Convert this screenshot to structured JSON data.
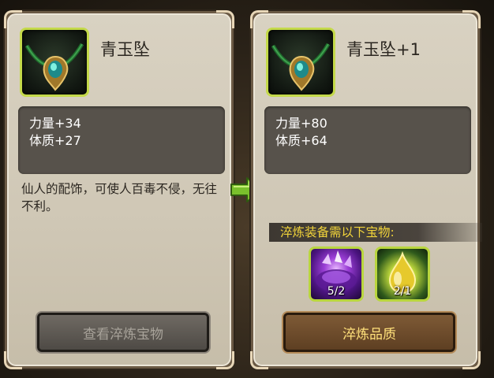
{
  "left_panel": {
    "item_name": "青玉坠",
    "stats": [
      "力量+34",
      "体质+27"
    ],
    "description": "仙人的配饰，可使人百毒不侵，无往不利。",
    "button_label": "查看淬炼宝物",
    "icon": "jade-pendant-icon"
  },
  "right_panel": {
    "item_name": "青玉坠+1",
    "stats": [
      "力量+80",
      "体质+64"
    ],
    "requirement_text": "淬炼装备需以下宝物:",
    "materials": [
      {
        "icon": "purple-crystal-icon",
        "count": "5/2"
      },
      {
        "icon": "golden-drop-icon",
        "count": "2/1"
      }
    ],
    "button_label": "淬炼品质",
    "icon": "jade-pendant-icon"
  },
  "arrow_icon": "right-arrow-icon",
  "colors": {
    "accent_green": "#c4d94a",
    "gold_text": "#f2d43a",
    "panel_bg": "#cfc7b5"
  }
}
